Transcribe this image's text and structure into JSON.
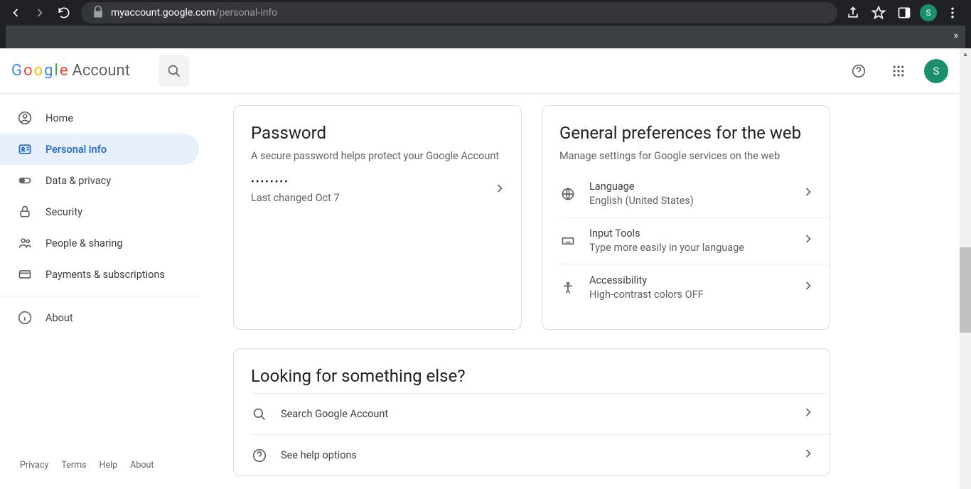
{
  "browser": {
    "url_domain": "myaccount.google.com",
    "url_path": "/personal-info",
    "avatar_initial": "S"
  },
  "header": {
    "logo_account": "Account",
    "avatar_initial": "S"
  },
  "sidebar": {
    "items": [
      {
        "label": "Home"
      },
      {
        "label": "Personal info"
      },
      {
        "label": "Data & privacy"
      },
      {
        "label": "Security"
      },
      {
        "label": "People & sharing"
      },
      {
        "label": "Payments & subscriptions"
      }
    ],
    "about": "About"
  },
  "footer": {
    "privacy": "Privacy",
    "terms": "Terms",
    "help": "Help",
    "about": "About"
  },
  "password_card": {
    "title": "Password",
    "subtitle": "A secure password helps protect your Google Account",
    "mask": "••••••••",
    "changed": "Last changed Oct 7"
  },
  "pref_card": {
    "title": "General preferences for the web",
    "subtitle": "Manage settings for Google services on the web",
    "items": [
      {
        "title": "Language",
        "sub": "English (United States)"
      },
      {
        "title": "Input Tools",
        "sub": "Type more easily in your language"
      },
      {
        "title": "Accessibility",
        "sub": "High-contrast colors OFF"
      }
    ]
  },
  "else_card": {
    "title": "Looking for something else?",
    "items": [
      {
        "label": "Search Google Account"
      },
      {
        "label": "See help options"
      }
    ]
  }
}
